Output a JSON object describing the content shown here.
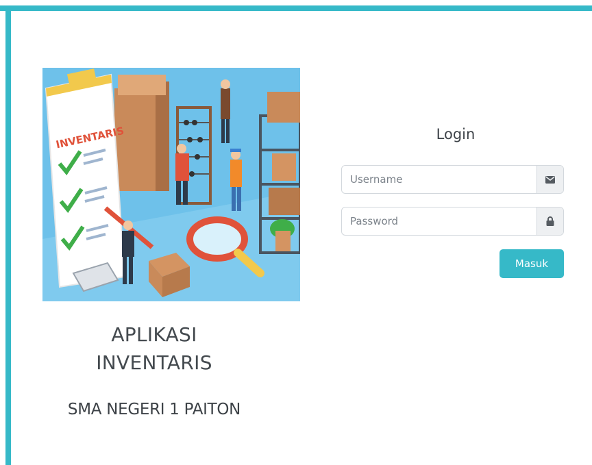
{
  "branding": {
    "title_line1": "APLIKASI",
    "title_line2": "INVENTARIS",
    "school": "SMA NEGERI 1 PAITON",
    "illustration_text": "INVENTARIS"
  },
  "login": {
    "title": "Login",
    "username_placeholder": "Username",
    "password_placeholder": "Password",
    "submit_label": "Masuk",
    "username_icon": "envelope-icon",
    "password_icon": "lock-icon"
  },
  "colors": {
    "accent": "#36b9c8",
    "illustration_bg": "#6ec1ea"
  }
}
